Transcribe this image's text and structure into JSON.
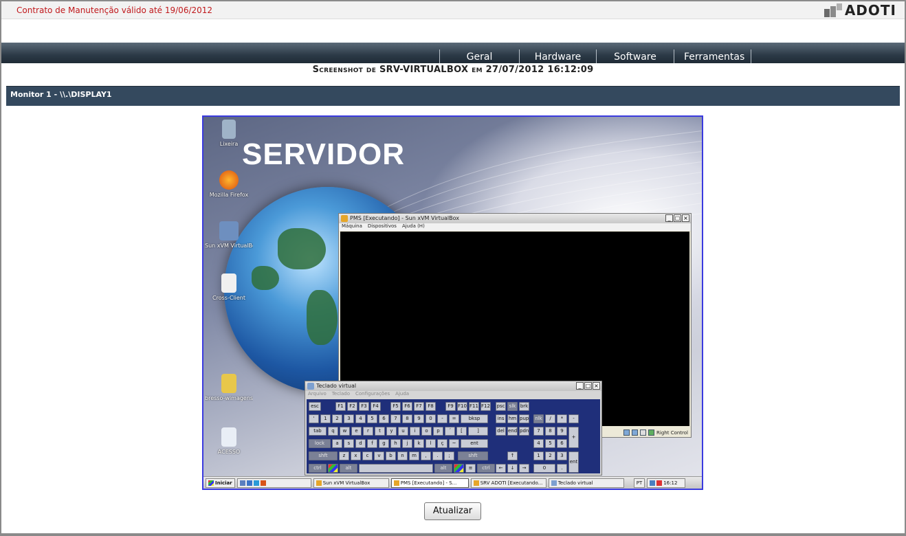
{
  "header": {
    "contract_text": "Contrato de Manutenção válido até 19/06/2012",
    "logo_text": "ADOTI"
  },
  "nav": {
    "items": [
      "Geral",
      "Hardware",
      "Software",
      "Ferramentas"
    ]
  },
  "page": {
    "heading": "Screenshot de SRV-VIRTUALBOX em 27/07/2012 16:12:09",
    "monitor_label": "Monitor 1 - \\\\.\\DISPLAY1",
    "update_button": "Atualizar"
  },
  "screenshot": {
    "wallpaper_title": "SERVIDOR",
    "desktop_icons": [
      "Lixeira",
      "Mozilla Firefox",
      "Sun xVM VirtualBox",
      "Cross-Client",
      "bresso-wimagens",
      "ACESSO"
    ],
    "vbox_window": {
      "title": "PMS [Executando] - Sun xVM VirtualBox",
      "menu": [
        "Máquina",
        "Dispositivos",
        "Ajuda (H)"
      ],
      "status": "Right Control"
    },
    "keyboard_window": {
      "title": "Teclado virtual",
      "menu": [
        "Arquivo",
        "Teclado",
        "Configurações",
        "Ajuda"
      ]
    },
    "taskbar": {
      "start": "Iniciar",
      "items": [
        "Sun xVM VirtualBox",
        "PMS [Executando] - S...",
        "SRV ADOTI [Executando...",
        "Teclado virtual"
      ],
      "lang": "PT",
      "clock": "16:12"
    }
  },
  "colors": {
    "contract_red": "#c0181b",
    "navbar": "#2c3a47",
    "monitor_bar": "#34495e",
    "screenshot_border": "#3a3adf"
  }
}
